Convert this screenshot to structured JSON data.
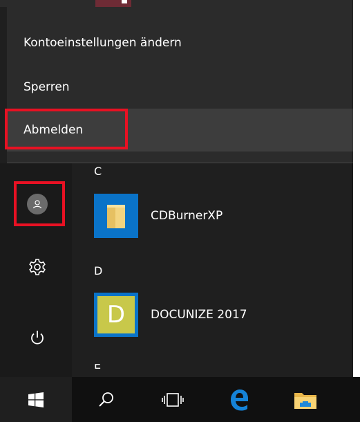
{
  "account_menu": {
    "items": [
      {
        "label": "Kontoeinstellungen ändern"
      },
      {
        "label": "Sperren"
      },
      {
        "label": "Abmelden"
      }
    ]
  },
  "app_list": {
    "groups": [
      {
        "letter": "C",
        "apps": [
          {
            "name": "CDBurnerXP",
            "icon": "folder-icon"
          }
        ]
      },
      {
        "letter": "D",
        "apps": [
          {
            "name": "DOCUNIZE 2017",
            "icon": "docunize-icon",
            "icon_text": "D"
          }
        ]
      },
      {
        "letter": "E"
      }
    ]
  },
  "rail": {
    "items": [
      {
        "name": "user-account-button",
        "icon": "user-icon"
      },
      {
        "name": "settings-button",
        "icon": "gear-icon"
      },
      {
        "name": "power-button",
        "icon": "power-icon"
      }
    ]
  },
  "taskbar": {
    "items": [
      "windows-logo-icon",
      "search-icon",
      "task-view-icon",
      "edge-icon",
      "file-explorer-icon"
    ]
  },
  "colors": {
    "menu_bg": "#2b2b2b",
    "start_bg": "#1f1f1f",
    "tile_blue": "#0a73c8",
    "docunize_tile": "#c8c84a",
    "highlight": "#e81123"
  }
}
